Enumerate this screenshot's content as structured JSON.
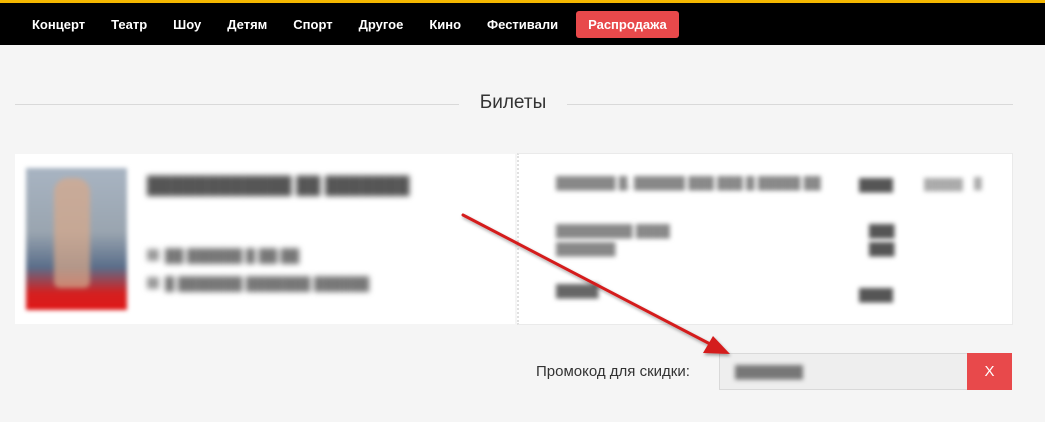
{
  "nav": {
    "items": [
      "Концерт",
      "Театр",
      "Шоу",
      "Детям",
      "Спорт",
      "Другое",
      "Кино",
      "Фестивали"
    ],
    "sale": "Распродажа"
  },
  "section": {
    "title": "Билеты"
  },
  "promo": {
    "label": "Промокод для скидки:",
    "remove_label": "X"
  },
  "colors": {
    "accent_yellow": "#f5b800",
    "sale_red": "#e8494b",
    "annotation_arrow": "#d41c1c"
  },
  "annotation": {
    "type": "arrow",
    "points_to": "promo-input"
  }
}
